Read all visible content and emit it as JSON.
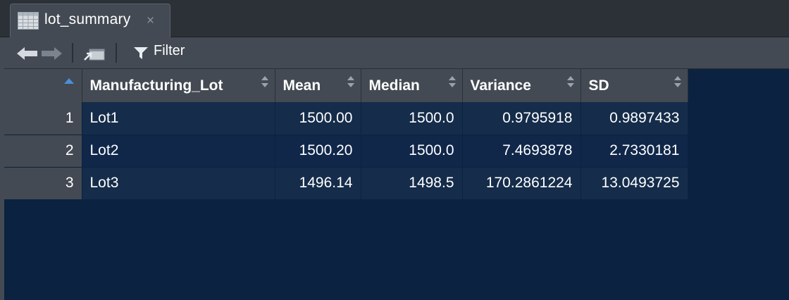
{
  "tab": {
    "title": "lot_summary",
    "close_glyph": "×",
    "icon": "grid-table-icon"
  },
  "toolbar": {
    "back_icon": "arrow-left-icon",
    "forward_icon": "arrow-right-icon",
    "popout_icon": "popout-window-icon",
    "filter_icon": "funnel-icon",
    "filter_label": "Filter"
  },
  "table": {
    "columns": [
      "Manufacturing_Lot",
      "Mean",
      "Median",
      "Variance",
      "SD"
    ],
    "rows": [
      {
        "num": "1",
        "lot": "Lot1",
        "mean": "1500.00",
        "median": "1500.0",
        "variance": "0.9795918",
        "sd": "0.9897433"
      },
      {
        "num": "2",
        "lot": "Lot2",
        "mean": "1500.20",
        "median": "1500.0",
        "variance": "7.4693878",
        "sd": "2.7330181"
      },
      {
        "num": "3",
        "lot": "Lot3",
        "mean": "1496.14",
        "median": "1498.5",
        "variance": "170.2861224",
        "sd": "13.0493725"
      }
    ]
  },
  "colors": {
    "background": "#0b2240",
    "header": "#434a53",
    "row": "#152c4a",
    "sort_accent": "#4a90d9"
  }
}
